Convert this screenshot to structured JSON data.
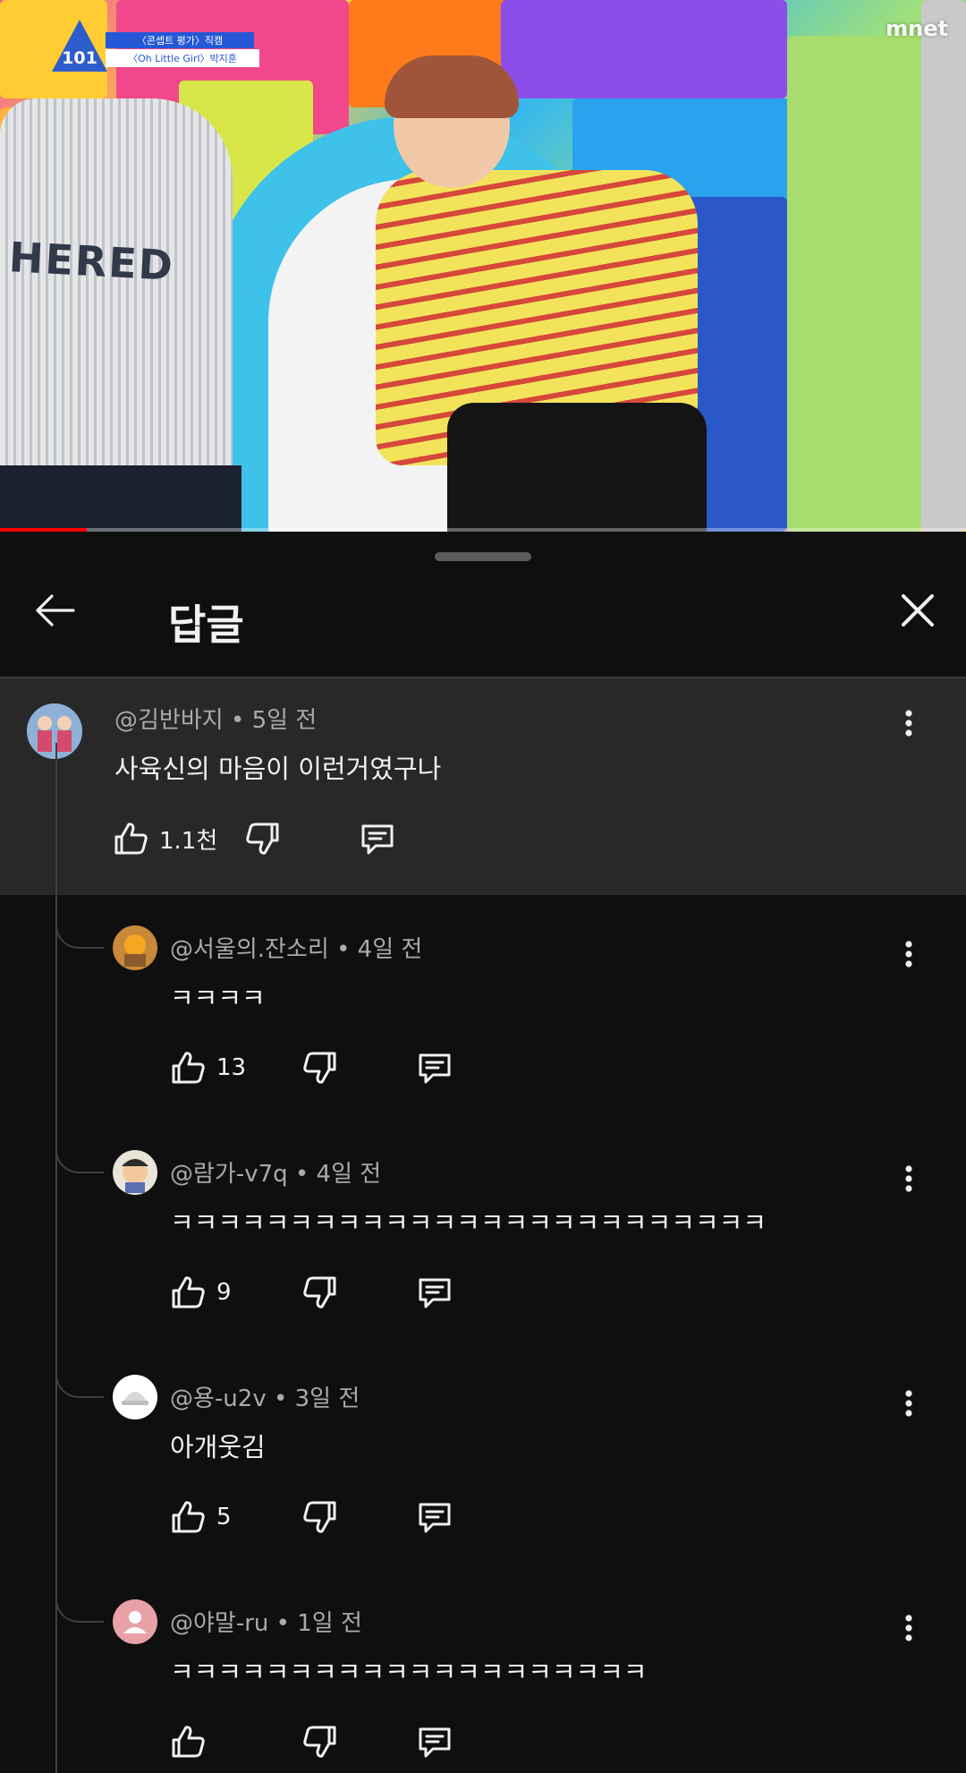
{
  "video": {
    "overlay_line1": "〈콘셉트 평가〉직캠",
    "overlay_line2": "〈Oh Little Girl〉박지훈",
    "logo_text": "101",
    "channel_logo": "mnet",
    "shirt_text": "HERED",
    "progress_fraction": 0.09
  },
  "sheet": {
    "title": "답글"
  },
  "parent_comment": {
    "author": "@김반바지",
    "age": "5일 전",
    "text": "사육신의 마음이 이런거였구나",
    "likes": "1.1천"
  },
  "replies": [
    {
      "author": "@서울의.잔소리",
      "age": "4일 전",
      "text": "ㅋㅋㅋㅋ",
      "likes": "13",
      "avatar_color": "#c8893a"
    },
    {
      "author": "@람가-v7q",
      "age": "4일 전",
      "text": "ㅋㅋㅋㅋㅋㅋㅋㅋㅋㅋㅋㅋㅋㅋㅋㅋㅋㅋㅋㅋㅋㅋㅋㅋㅋ",
      "likes": "9",
      "avatar_color": "#5b6fb3"
    },
    {
      "author": "@용-u2v",
      "age": "3일 전",
      "text": "아개웃김",
      "likes": "5",
      "avatar_color": "#f2f2f2"
    },
    {
      "author": "@야말-ru",
      "age": "1일 전",
      "text": "ㅋㅋㅋㅋㅋㅋㅋㅋㅋㅋㅋㅋㅋㅋㅋㅋㅋㅋㅋㅋ",
      "likes": "",
      "avatar_color": "#e8a1a6"
    }
  ],
  "icons": {
    "back": "arrow-left-icon",
    "close": "close-icon",
    "like": "thumb-up-icon",
    "dislike": "thumb-down-icon",
    "reply": "comment-icon",
    "more": "more-vert-icon"
  },
  "colors": {
    "background": "#0f0f0f",
    "highlight": "#282828",
    "secondary_text": "#aaaaaa",
    "progress": "#ff0000"
  }
}
